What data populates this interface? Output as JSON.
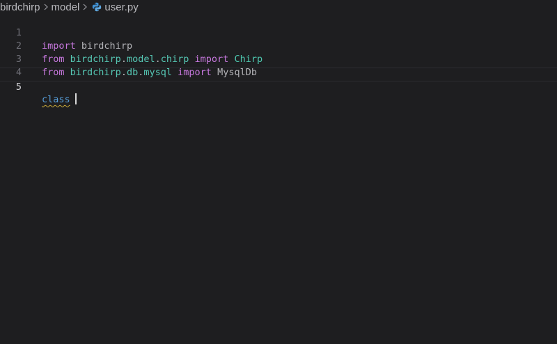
{
  "breadcrumb": {
    "items": [
      "birdchirp",
      "model"
    ],
    "file": "user.py"
  },
  "icons": {
    "separator": "chevron-right-icon",
    "file": "python-icon"
  },
  "colors": {
    "background": "#1e1e20",
    "keyword": "#c678dd",
    "module": "#56c7b4",
    "class_name": "#4ec9b0",
    "class_keyword": "#569cd6",
    "warning_squiggle": "#c8a93a"
  },
  "editor": {
    "current_line": 5,
    "lines": [
      {
        "number": "1",
        "tokens": [
          "import",
          "birdchirp"
        ]
      },
      {
        "number": "2",
        "tokens": [
          "from",
          "birdchirp",
          ".",
          "model",
          ".",
          "chirp",
          "import",
          "Chirp"
        ]
      },
      {
        "number": "3",
        "tokens": [
          "from",
          "birdchirp",
          ".",
          "db",
          ".",
          "mysql",
          "import",
          "MysqlDb"
        ]
      },
      {
        "number": "4",
        "tokens": []
      },
      {
        "number": "5",
        "tokens": [
          "class"
        ]
      }
    ]
  }
}
